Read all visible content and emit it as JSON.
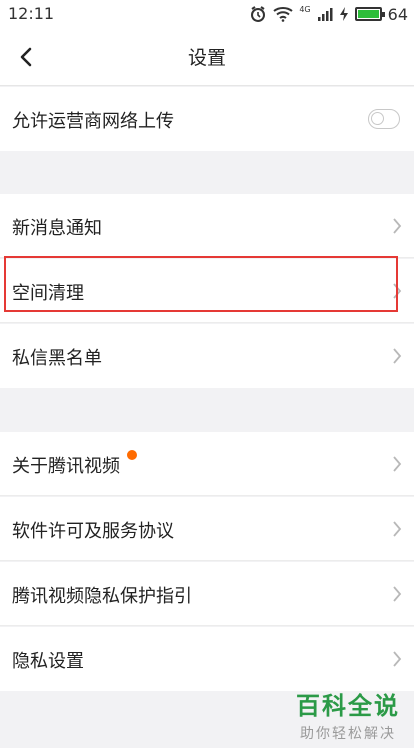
{
  "status": {
    "time": "12:11",
    "battery": "64",
    "network": "4G"
  },
  "header": {
    "title": "设置"
  },
  "settings": {
    "carrier_upload": "允许运营商网络上传",
    "new_message": "新消息通知",
    "space_cleanup": "空间清理",
    "dm_blacklist": "私信黑名单",
    "about": "关于腾讯视频",
    "software_license": "软件许可及服务协议",
    "privacy_guide": "腾讯视频隐私保护指引",
    "privacy_settings": "隐私设置"
  },
  "colors": {
    "accent_badge": "#ff6b00",
    "highlight": "#e53935",
    "watermark": "#2b9a47"
  },
  "watermark": {
    "title": "百科全说",
    "subtitle": "助你轻松解决"
  },
  "icons": [
    "alarm-icon",
    "wifi-icon",
    "signal-icon",
    "charging-icon",
    "battery-icon",
    "back-arrow-icon",
    "chevron-right-icon"
  ]
}
